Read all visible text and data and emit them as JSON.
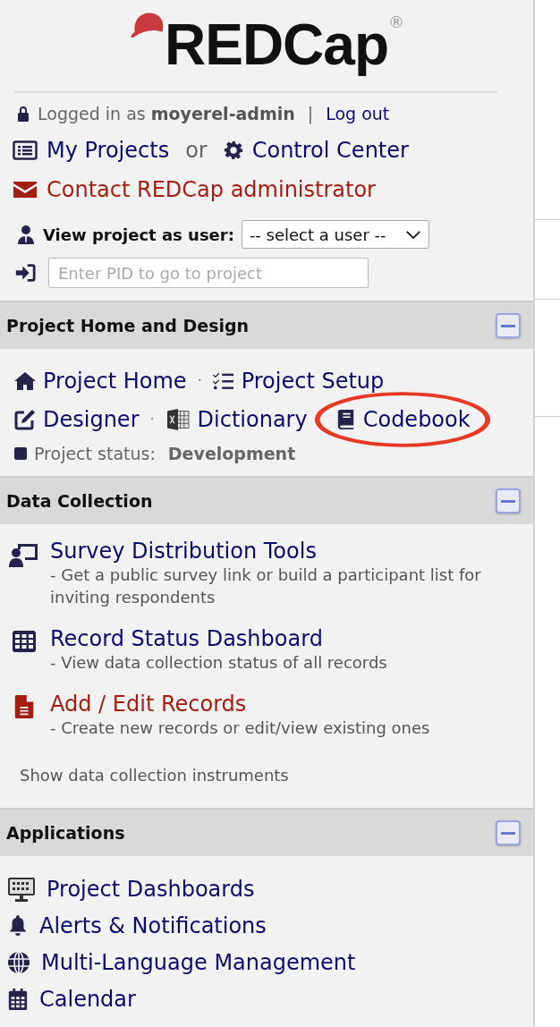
{
  "logo": {
    "text": "REDCap",
    "mark": "®"
  },
  "login": {
    "prefix": "Logged in as",
    "user": "moyerel-admin",
    "separator": "|",
    "logout": "Log out"
  },
  "nav": {
    "my_projects": "My Projects",
    "or": "or",
    "control_center": "Control Center",
    "contact": "Contact REDCap administrator"
  },
  "view_as": {
    "label": "View project as user:",
    "value": "-- select a user --"
  },
  "pid_field": {
    "placeholder": "Enter PID to go to project"
  },
  "design": {
    "title": "Project Home and Design",
    "expanded": true,
    "rows": [
      [
        {
          "label": "Project Home"
        },
        {
          "sep": "·",
          "label": "Project Setup"
        }
      ],
      [
        {
          "label": "Designer"
        },
        {
          "sep": "·",
          "label": "Dictionary"
        },
        {
          "label": "Codebook"
        }
      ]
    ],
    "status": {
      "label": "Project status:",
      "value": "Development"
    }
  },
  "data_collection": {
    "title": "Data Collection",
    "expanded": true,
    "items": [
      {
        "label": "Survey Distribution Tools",
        "color": "#0c0c6b",
        "description": "- Get a public survey link or build a participant list for inviting respondents"
      },
      {
        "label": "Record Status Dashboard",
        "color": "#0c0c6b",
        "description": "- View data collection status of all records"
      },
      {
        "label": "Add / Edit Records",
        "color": "#a31d12",
        "description": "- Create new records or edit/view existing ones"
      }
    ],
    "footer": "Show data collection instruments"
  },
  "applications": {
    "title": "Applications",
    "expanded": true,
    "items": [
      {
        "label": "Project Dashboards"
      },
      {
        "label": "Alerts & Notifications"
      },
      {
        "label": "Multi-Language Management"
      },
      {
        "label": "Calendar"
      }
    ]
  }
}
